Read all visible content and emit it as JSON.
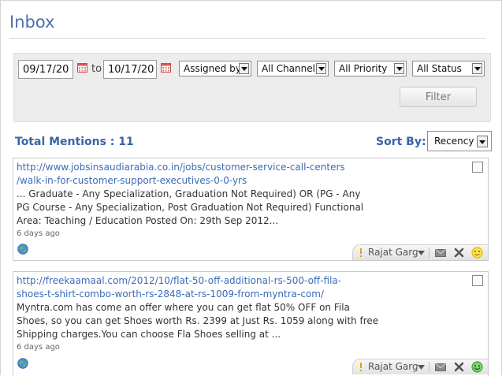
{
  "page": {
    "title": "Inbox"
  },
  "filters": {
    "date_from": "09/17/20",
    "to_label": "to",
    "date_to": "10/17/20",
    "assigned_by": "Assigned by",
    "channel": "All Channel",
    "priority": "All Priority",
    "status": "All Status",
    "filter_button": "Filter"
  },
  "summary": {
    "total_mentions_label": "Total Mentions : 11",
    "sort_by_label": "Sort By:",
    "sort_value": "Recency"
  },
  "mentions": [
    {
      "url_line1": "http://www.jobsinsaudiarabia.co.in/jobs/customer-service-call-centers",
      "url_line2": "/walk-in-for-customer-support-executives-0-0-yrs",
      "text_line1": "... Graduate - Any Specialization, Graduation Not Required) OR (PG - Any",
      "text_line2": "PG Course - Any Specialization, Post Graduation Not Required) Functional",
      "text_line3": "Area: Teaching / Education Posted On: 29th Sep 2012...",
      "age": "6 days ago",
      "assignee": "Rajat Garg",
      "sentiment": "neutral"
    },
    {
      "url_line1": "http://freekaamaal.com/2012/10/flat-50-off-additional-rs-500-off-fila-",
      "url_line2": "shoes-t-shirt-combo-worth-rs-2848-at-rs-1009-from-myntra-com/",
      "text_line1": "Myntra.com has come an offer where you can get flat 50% OFF on Fila",
      "text_line2": "Shoes, so you can get Shoes worth Rs. 2399 at Just Rs. 1059 along with free",
      "text_line3": "Shipping charges.You can choose Fla Shoes selling at ...",
      "age": "6 days ago",
      "assignee": "Rajat Garg",
      "sentiment": "positive"
    }
  ],
  "colors": {
    "accent": "#3a64a8",
    "link": "#3b6cb6",
    "neutral_face": "#e8b800",
    "positive_face": "#3aa34a"
  }
}
